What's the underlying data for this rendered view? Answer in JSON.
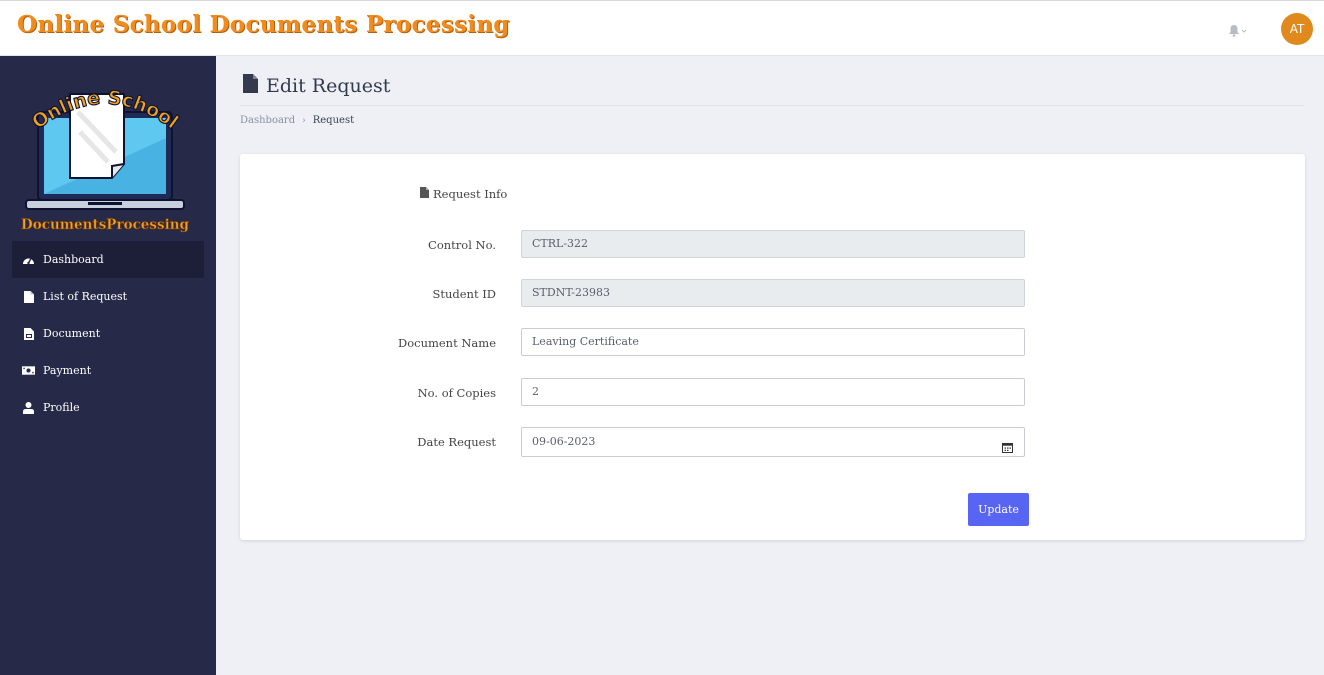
{
  "header": {
    "app_title": "Online School Documents Processing",
    "avatar_initials": "AT"
  },
  "logo": {
    "top_text": "Online School",
    "bottom_text": "DocumentsProcessing"
  },
  "sidebar": {
    "items": [
      {
        "label": "Dashboard",
        "icon": "dashboard-gauge-icon",
        "active": true
      },
      {
        "label": "List of Request",
        "icon": "file-icon",
        "active": false
      },
      {
        "label": "Document",
        "icon": "document-icon",
        "active": false
      },
      {
        "label": "Payment",
        "icon": "money-bill-icon",
        "active": false
      },
      {
        "label": "Profile",
        "icon": "user-icon",
        "active": false
      }
    ]
  },
  "page": {
    "title": "Edit Request",
    "breadcrumb": [
      "Dashboard",
      "Request"
    ]
  },
  "form": {
    "section_title": "Request Info",
    "control_no_label": "Control No.",
    "control_no_value": "CTRL-322",
    "student_id_label": "Student ID",
    "student_id_value": "STDNT-23983",
    "document_name_label": "Document Name",
    "document_name_value": "Leaving Certificate",
    "copies_label": "No. of Copies",
    "copies_value": "2",
    "date_label": "Date Request",
    "date_value": "09-06-2023",
    "submit_label": "Update"
  },
  "colors": {
    "sidebar_bg": "#262a48",
    "brand_orange": "#f08b1e",
    "button_blue": "#5865f2",
    "avatar_bg": "#e08a1e"
  }
}
